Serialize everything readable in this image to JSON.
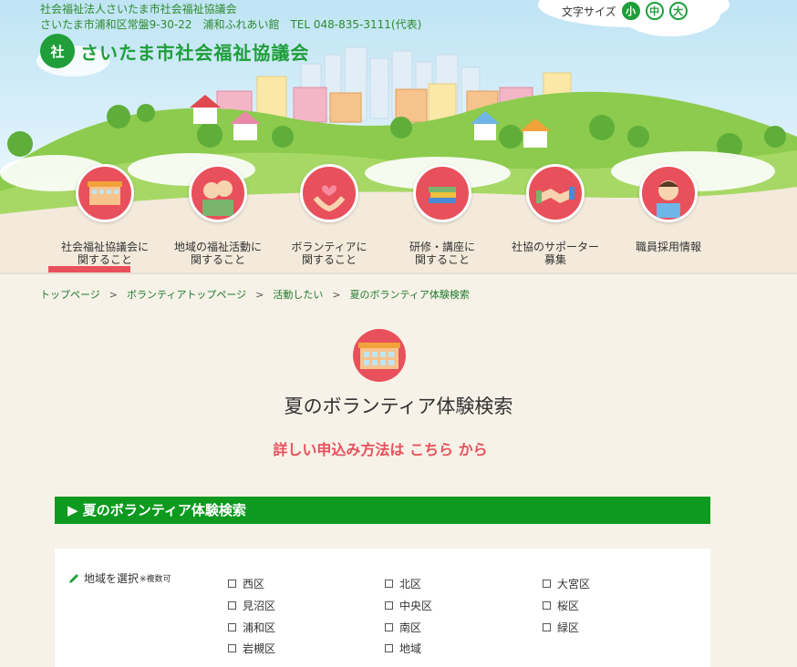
{
  "header": {
    "org_line1": "社会福祉法人さいたま市社会福祉協議会",
    "org_line2": "さいたま市浦和区常盤9-30-22　浦和ふれあい館　TEL 048-835-3111(代表)",
    "logo_mark": "社",
    "logo_text": "さいたま市社会福祉協議会",
    "font_size_label": "文字サイズ",
    "font_sizes": [
      "小",
      "中",
      "大"
    ]
  },
  "nav": {
    "items": [
      {
        "label1": "社会福祉協議会に",
        "label2": "関すること"
      },
      {
        "label1": "地域の福祉活動に",
        "label2": "関すること"
      },
      {
        "label1": "ボランティアに",
        "label2": "関すること"
      },
      {
        "label1": "研修・講座に",
        "label2": "関すること"
      },
      {
        "label1": "社協のサポーター",
        "label2": "募集"
      },
      {
        "label1": "職員採用情報",
        "label2": ""
      }
    ]
  },
  "breadcrumb": [
    "トップページ",
    "ボランティアトップページ",
    "活動したい",
    "夏のボランティア体験検索"
  ],
  "breadcrumb_sep": ">",
  "page": {
    "title": "夏のボランティア体験検索",
    "apply_link": "詳しい申込み方法は こちら から"
  },
  "section": {
    "title": "▶ 夏のボランティア体験検索",
    "region_label": "地域を選択",
    "region_note": "※複数可",
    "regions": [
      "西区",
      "北区",
      "大宮区",
      "見沼区",
      "中央区",
      "桜区",
      "浦和区",
      "南区",
      "緑区",
      "岩槻区",
      "地域"
    ]
  },
  "colors": {
    "accent_green": "#0e9a1f",
    "accent_red": "#e8505b"
  }
}
